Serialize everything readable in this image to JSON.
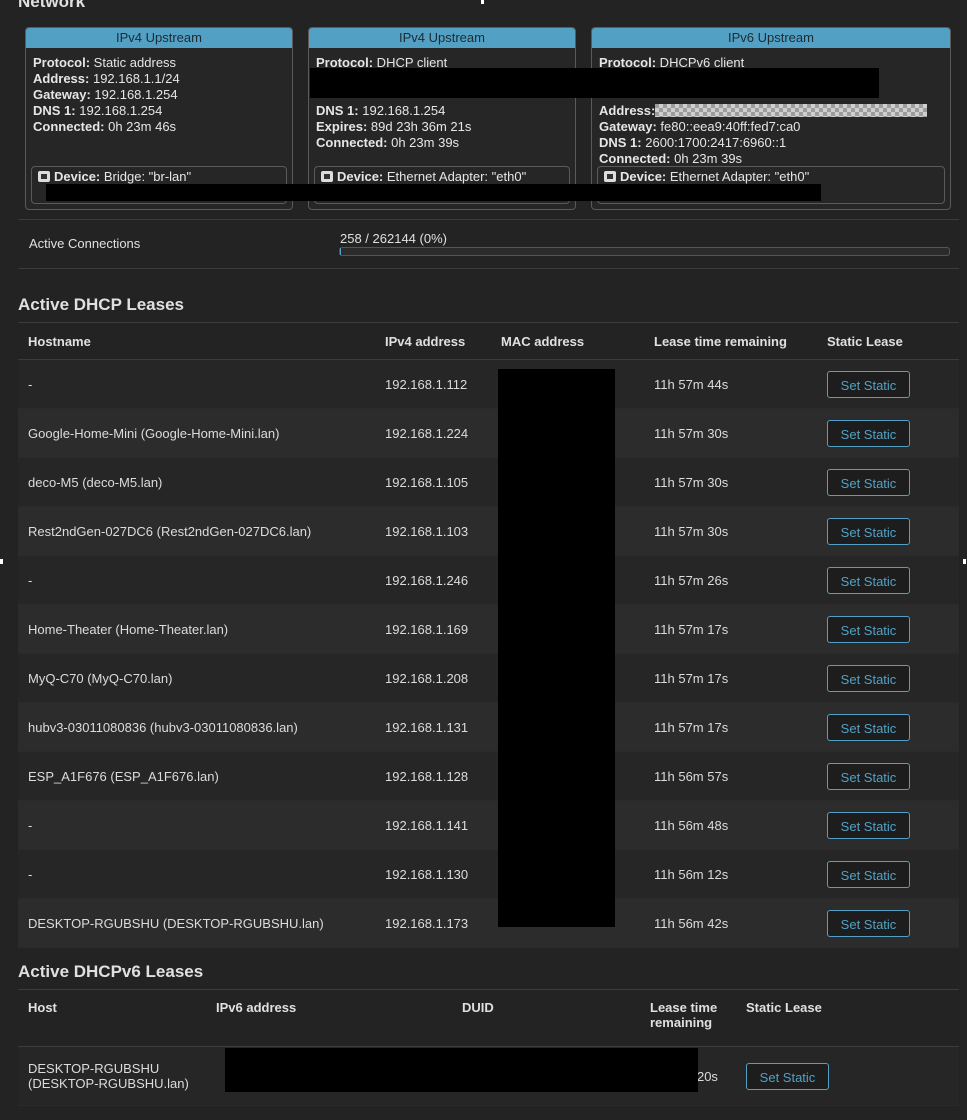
{
  "network": {
    "title": "Network",
    "cards": [
      {
        "title": "IPv4 Upstream",
        "lines": [
          {
            "k": "Protocol:",
            "v": " Static address"
          },
          {
            "k": "Address:",
            "v": " 192.168.1.1/24"
          },
          {
            "k": "Gateway:",
            "v": " 192.168.1.254"
          },
          {
            "k": "DNS 1:",
            "v": " 192.168.1.254"
          },
          {
            "k": "Connected:",
            "v": " 0h 23m 46s"
          }
        ],
        "device_k": "Device:",
        "device_v": " Bridge: \"br-lan\""
      },
      {
        "title": "IPv4 Upstream",
        "lines": [
          {
            "k": "Protocol:",
            "v": " DHCP client"
          },
          {
            "k": "",
            "v": ""
          },
          {
            "k": "",
            "v": ""
          },
          {
            "k": "DNS 1:",
            "v": " 192.168.1.254"
          },
          {
            "k": "Expires:",
            "v": " 89d 23h 36m 21s"
          },
          {
            "k": "Connected:",
            "v": " 0h 23m 39s"
          }
        ],
        "device_k": "Device:",
        "device_v": " Ethernet Adapter: \"eth0\""
      },
      {
        "title": "IPv6 Upstream",
        "lines": [
          {
            "k": "Protocol:",
            "v": " DHCPv6 client"
          },
          {
            "k": "",
            "v": ""
          },
          {
            "k": "",
            "v": ""
          },
          {
            "k": "Address:",
            "v": ""
          },
          {
            "k": "Gateway:",
            "v": " fe80::eea9:40ff:fed7:ca0"
          },
          {
            "k": "DNS 1:",
            "v": " 2600:1700:2417:6960::1"
          },
          {
            "k": "Connected:",
            "v": " 0h 23m 39s"
          }
        ],
        "device_k": "Device:",
        "device_v": " Ethernet Adapter: \"eth0\""
      }
    ],
    "active_connections": {
      "label": "Active Connections",
      "value": "258 / 262144 (0%)",
      "fraction": 0.001
    }
  },
  "dhcp": {
    "title": "Active DHCP Leases",
    "headers": [
      "Hostname",
      "IPv4 address",
      "MAC address",
      "Lease time remaining",
      "Static Lease"
    ],
    "button_label": "Set Static",
    "rows": [
      {
        "host": "-",
        "ip": "192.168.1.112",
        "lease": "11h 57m 44s"
      },
      {
        "host": "Google-Home-Mini (Google-Home-Mini.lan)",
        "ip": "192.168.1.224",
        "lease": "11h 57m 30s"
      },
      {
        "host": "deco-M5 (deco-M5.lan)",
        "ip": "192.168.1.105",
        "lease": "11h 57m 30s"
      },
      {
        "host": "Rest2ndGen-027DC6 (Rest2ndGen-027DC6.lan)",
        "ip": "192.168.1.103",
        "lease": "11h 57m 30s"
      },
      {
        "host": "-",
        "ip": "192.168.1.246",
        "lease": "11h 57m 26s"
      },
      {
        "host": "Home-Theater (Home-Theater.lan)",
        "ip": "192.168.1.169",
        "lease": "11h 57m 17s"
      },
      {
        "host": "MyQ-C70 (MyQ-C70.lan)",
        "ip": "192.168.1.208",
        "lease": "11h 57m 17s"
      },
      {
        "host": "hubv3-03011080836 (hubv3-03011080836.lan)",
        "ip": "192.168.1.131",
        "lease": "11h 57m 17s"
      },
      {
        "host": "ESP_A1F676 (ESP_A1F676.lan)",
        "ip": "192.168.1.128",
        "lease": "11h 56m 57s"
      },
      {
        "host": "-",
        "ip": "192.168.1.141",
        "lease": "11h 56m 48s"
      },
      {
        "host": "-",
        "ip": "192.168.1.130",
        "lease": "11h 56m 12s"
      },
      {
        "host": "DESKTOP-RGUBSHU (DESKTOP-RGUBSHU.lan)",
        "ip": "192.168.1.173",
        "lease": "11h 56m 42s"
      }
    ]
  },
  "dhcpv6": {
    "title": "Active DHCPv6 Leases",
    "headers": [
      "Host",
      "IPv6 address",
      "DUID",
      "Lease time remaining",
      "Static Lease"
    ],
    "button_label": "Set Static",
    "rows": [
      {
        "host": "DESKTOP-RGUBSHU (DESKTOP-RGUBSHU.lan)",
        "lease": "0h 36m 20s"
      }
    ]
  },
  "colors": {
    "accent": "#52a1c5",
    "background": "#232323"
  },
  "icons": {
    "device": "network-port-icon"
  }
}
